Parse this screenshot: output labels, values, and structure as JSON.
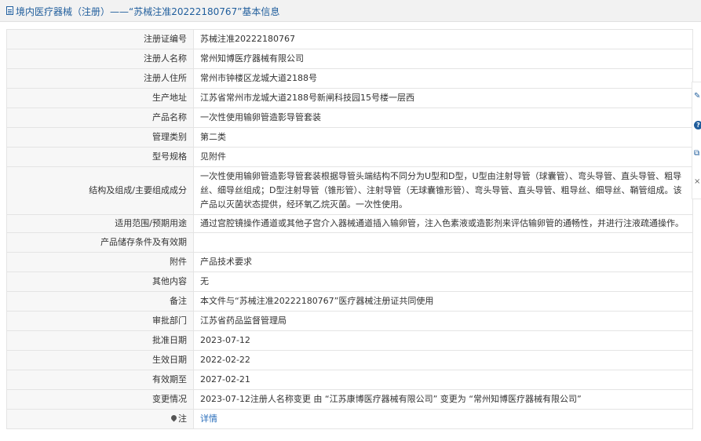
{
  "header": {
    "title": "境内医疗器械（注册）——“苏械注准20222180767”基本信息"
  },
  "rows": [
    {
      "label": "注册证编号",
      "value": "苏械注准20222180767"
    },
    {
      "label": "注册人名称",
      "value": "常州知博医疗器械有限公司"
    },
    {
      "label": "注册人住所",
      "value": "常州市钟楼区龙城大道2188号"
    },
    {
      "label": "生产地址",
      "value": "江苏省常州市龙城大道2188号新闸科技园15号楼一层西"
    },
    {
      "label": "产品名称",
      "value": "一次性使用输卵管造影导管套装"
    },
    {
      "label": "管理类别",
      "value": "第二类"
    },
    {
      "label": "型号规格",
      "value": "见附件"
    },
    {
      "label": "结构及组成/主要组成成分",
      "value": "一次性使用输卵管造影导管套装根据导管头端结构不同分为U型和D型，U型由注射导管（球囊管）、弯头导管、直头导管、粗导丝、细导丝组成；D型注射导管（锥形管）、注射导管（无球囊锥形管）、弯头导管、直头导管、粗导丝、细导丝、鞘管组成。该产品以灭菌状态提供，经环氧乙烷灭菌。一次性使用。"
    },
    {
      "label": "适用范围/预期用途",
      "value": "通过宫腔镜操作通道或其他子宫介入器械通道插入输卵管，注入色素液或造影剂来评估输卵管的通畅性，并进行注液疏通操作。"
    },
    {
      "label": "产品储存条件及有效期",
      "value": ""
    },
    {
      "label": "附件",
      "value": "产品技术要求"
    },
    {
      "label": "其他内容",
      "value": "无"
    },
    {
      "label": "备注",
      "value": "本文件与“苏械注准20222180767”医疗器械注册证共同使用"
    },
    {
      "label": "审批部门",
      "value": "江苏省药品监督管理局"
    },
    {
      "label": "批准日期",
      "value": "2023-07-12"
    },
    {
      "label": "生效日期",
      "value": "2022-02-22"
    },
    {
      "label": "有效期至",
      "value": "2027-02-21"
    },
    {
      "label": "变更情况",
      "value": "2023-07-12注册人名称变更 由 “江苏康博医疗器械有限公司” 变更为 “常州知博医疗器械有限公司”"
    },
    {
      "label": "注",
      "value": "详情"
    }
  ],
  "icons": {
    "header": "document-icon",
    "note": "pin-icon",
    "side_toolbar": [
      "edit-icon",
      "help-icon",
      "copy-icon",
      "close-icon"
    ]
  },
  "colors": {
    "title": "#1f5d9c",
    "link": "#2a6ebb",
    "label_bg": "#f7f7f7",
    "border": "#e4e4e4"
  }
}
